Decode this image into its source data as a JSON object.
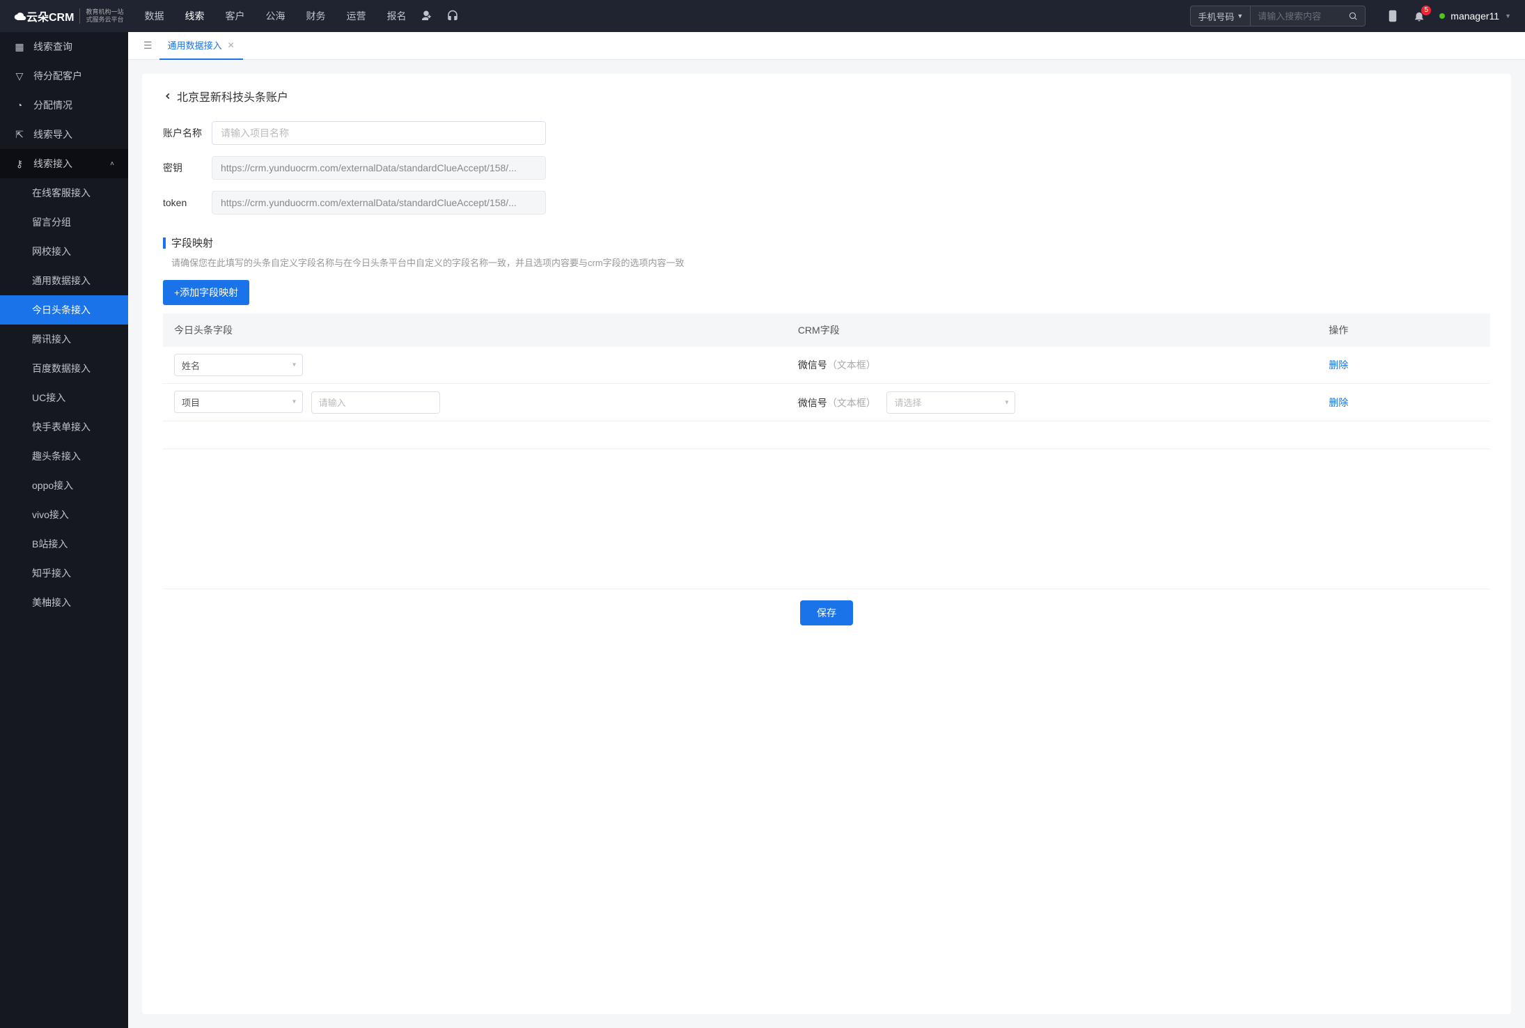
{
  "logo": {
    "brand": "云朵CRM",
    "sub1": "教育机构一站",
    "sub2": "式服务云平台"
  },
  "nav": {
    "items": [
      {
        "label": "数据"
      },
      {
        "label": "线索",
        "active": true
      },
      {
        "label": "客户"
      },
      {
        "label": "公海"
      },
      {
        "label": "财务"
      },
      {
        "label": "运营"
      },
      {
        "label": "报名"
      }
    ]
  },
  "search": {
    "select_label": "手机号码",
    "placeholder": "请输入搜索内容"
  },
  "notif": {
    "count": "5"
  },
  "user": {
    "name": "manager11"
  },
  "sidebar": {
    "items": [
      {
        "label": "线索查询",
        "icon": "grid"
      },
      {
        "label": "待分配客户",
        "icon": "filter"
      },
      {
        "label": "分配情况",
        "icon": "clock"
      },
      {
        "label": "线索导入",
        "icon": "export"
      }
    ],
    "group": {
      "label": "线索接入",
      "icon": "plug",
      "children": [
        {
          "label": "在线客服接入"
        },
        {
          "label": "留言分组"
        },
        {
          "label": "网校接入"
        },
        {
          "label": "通用数据接入"
        },
        {
          "label": "今日头条接入",
          "active": true
        },
        {
          "label": "腾讯接入"
        },
        {
          "label": "百度数据接入"
        },
        {
          "label": "UC接入"
        },
        {
          "label": "快手表单接入"
        },
        {
          "label": "趣头条接入"
        },
        {
          "label": "oppo接入"
        },
        {
          "label": "vivo接入"
        },
        {
          "label": "B站接入"
        },
        {
          "label": "知乎接入"
        },
        {
          "label": "美柚接入"
        }
      ]
    }
  },
  "tabs": {
    "active": {
      "label": "通用数据接入"
    }
  },
  "page": {
    "title": "北京昱新科技头条账户",
    "form": {
      "account_label": "账户名称",
      "account_placeholder": "请输入项目名称",
      "secret_label": "密钥",
      "secret_value": "https://crm.yunduocrm.com/externalData/standardClueAccept/158/...",
      "token_label": "token",
      "token_value": "https://crm.yunduocrm.com/externalData/standardClueAccept/158/..."
    },
    "mapping": {
      "title": "字段映射",
      "hint": "请确保您在此填写的头条自定义字段名称与在今日头条平台中自定义的字段名称一致，并且选项内容要与crm字段的选项内容一致",
      "add_btn": "+添加字段映射",
      "cols": {
        "src": "今日头条字段",
        "crm": "CRM字段",
        "op": "操作"
      },
      "rows": [
        {
          "src": "姓名",
          "crm": "微信号",
          "crm_hint": "（文本框）",
          "delete": "删除"
        },
        {
          "src": "项目",
          "input_placeholder": "请输入",
          "crm": "微信号",
          "crm_hint": "（文本框）",
          "select_placeholder": "请选择",
          "delete": "删除"
        }
      ]
    },
    "save": "保存"
  }
}
